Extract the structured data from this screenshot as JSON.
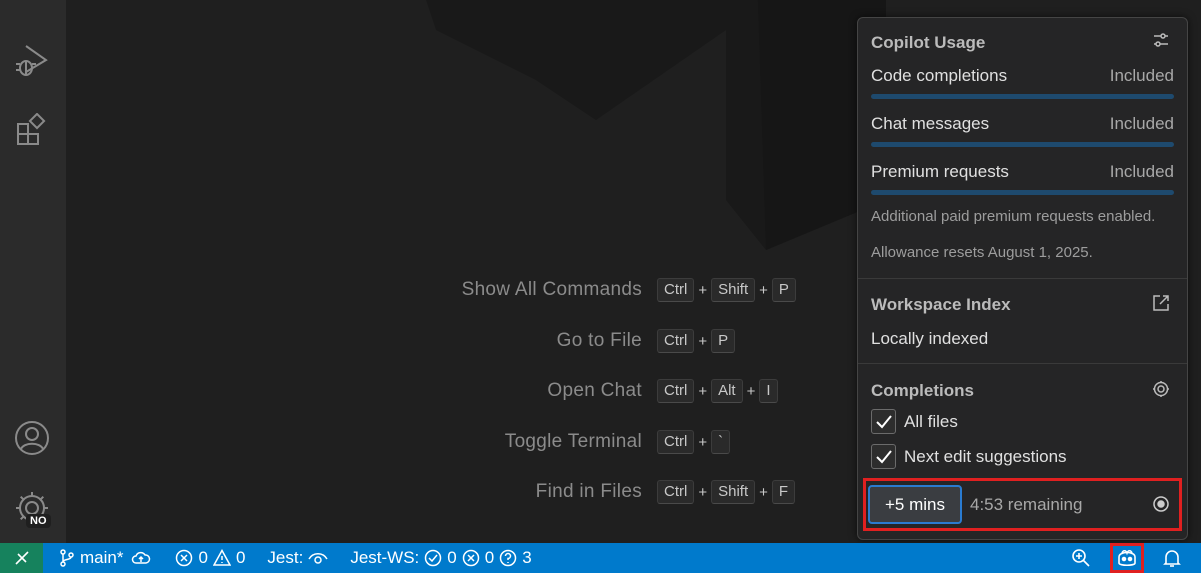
{
  "shortcuts": [
    {
      "label": "Show All Commands",
      "keys": [
        "Ctrl",
        "Shift",
        "P"
      ]
    },
    {
      "label": "Go to File",
      "keys": [
        "Ctrl",
        "P"
      ]
    },
    {
      "label": "Open Chat",
      "keys": [
        "Ctrl",
        "Alt",
        "I"
      ]
    },
    {
      "label": "Toggle Terminal",
      "keys": [
        "Ctrl",
        "`"
      ]
    },
    {
      "label": "Find in Files",
      "keys": [
        "Ctrl",
        "Shift",
        "F"
      ]
    }
  ],
  "plus": "+",
  "activity_bar": {
    "icons": [
      "run-debug-icon",
      "extensions-icon",
      "account-icon",
      "manage-gear-icon"
    ],
    "badge": "NO"
  },
  "statusbar": {
    "branch": "main*",
    "errors": "0",
    "warnings": "0",
    "jest": "Jest:",
    "jest_ws": "Jest-WS:",
    "ws_pass": "0",
    "ws_fail": "0",
    "ws_unknown": "3"
  },
  "popup": {
    "title": "Copilot Usage",
    "usage": [
      {
        "label": "Code completions",
        "value": "Included",
        "fill": 1.0
      },
      {
        "label": "Chat messages",
        "value": "Included",
        "fill": 1.0
      },
      {
        "label": "Premium requests",
        "value": "Included",
        "fill": 1.0
      }
    ],
    "note_paid": "Additional paid premium requests enabled.",
    "note_reset": "Allowance resets August 1, 2025.",
    "workspace_title": "Workspace Index",
    "workspace_status": "Locally indexed",
    "completions_title": "Completions",
    "check_all_files": "All files",
    "check_next_edit": "Next edit suggestions",
    "snooze_button": "+5 mins",
    "snooze_remaining": "4:53 remaining"
  },
  "colors": {
    "statusbar": "#007acc",
    "remote": "#16825d",
    "usage_bar": "#1e4a6e",
    "highlight": "#e02020"
  }
}
